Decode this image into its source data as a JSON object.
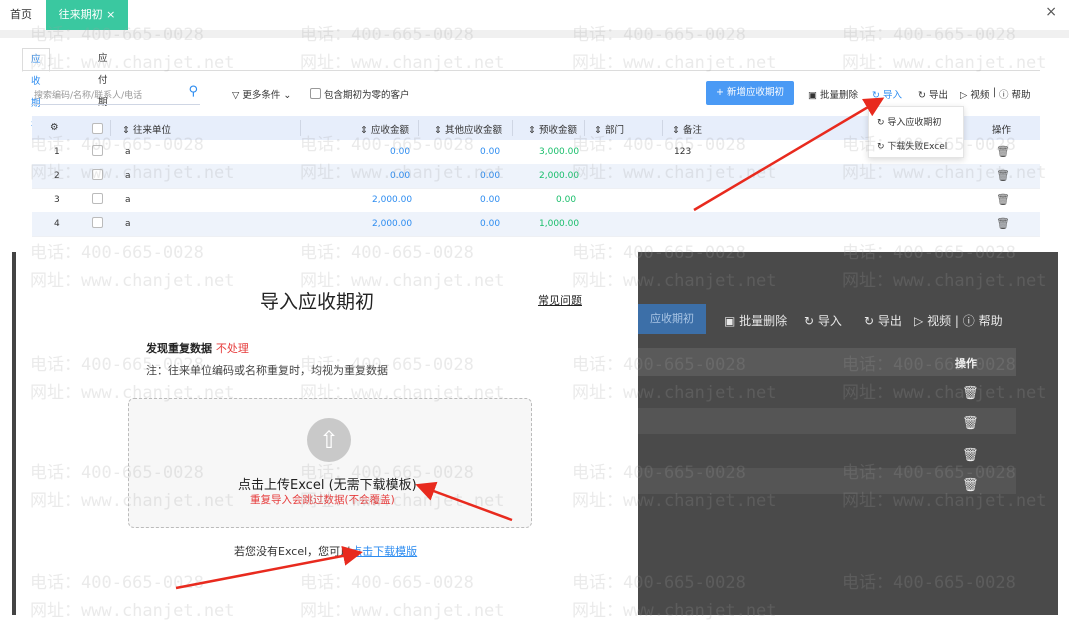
{
  "top_tabs": {
    "home": "首页",
    "active": "往来期初",
    "close_active": "×",
    "close_window": "×"
  },
  "sub_tabs": {
    "receivable": "应收期初",
    "payable": "应付期初"
  },
  "toolbar": {
    "search_placeholder": "搜索编码/名称/联系人/电话",
    "more_conditions": "更多条件",
    "include_zero": "包含期初为零的客户",
    "new_button": "+ 新增应收期初",
    "batch_delete": "批量删除",
    "import": "导入",
    "export": "导出",
    "video": "视频",
    "help": "帮助"
  },
  "table": {
    "headers": {
      "unit": "往来单位",
      "receivable": "应收金额",
      "other": "其他应收金额",
      "prepaid": "预收金额",
      "dept": "部门",
      "remark": "备注",
      "action": "操作"
    },
    "rows": [
      {
        "no": "1",
        "unit": "a",
        "receivable": "0.00",
        "other": "0.00",
        "prepaid": "3,000.00",
        "remark": "123"
      },
      {
        "no": "2",
        "unit": "a",
        "receivable": "0.00",
        "other": "0.00",
        "prepaid": "2,000.00",
        "remark": ""
      },
      {
        "no": "3",
        "unit": "a",
        "receivable": "2,000.00",
        "other": "0.00",
        "prepaid": "0.00",
        "remark": ""
      },
      {
        "no": "4",
        "unit": "a",
        "receivable": "2,000.00",
        "other": "0.00",
        "prepaid": "1,000.00",
        "remark": ""
      }
    ]
  },
  "dropdown": {
    "import_receivable": "导入应收期初",
    "download_failed": "下载失败Excel"
  },
  "dialog": {
    "title": "导入应收期初",
    "faq": "常见问题",
    "dup_label": "发现重复数据",
    "dup_value": "不处理",
    "note": "注：往来单位编码或名称重复时，均视为重复数据",
    "upload_text": "点击上传Excel (无需下载模板)",
    "upload_warning": "重复导入会跳过数据(不会覆盖)",
    "template_prefix": "若您没有Excel，您可以",
    "template_link": "点击下载模版"
  },
  "overlay": {
    "new_button": "应收期初",
    "batch_delete": "批量删除",
    "import": "导入",
    "export": "导出",
    "video": "视频",
    "help": "帮助",
    "action": "操作"
  },
  "watermark": {
    "phone": "电话：400-665-0028",
    "site": "网址：www.chanjet.net"
  },
  "colors": {
    "accent_tab": "#3ac8a0",
    "primary": "#4a9af5",
    "link": "#2d8cf0",
    "green": "#19be6b",
    "red": "#e63c3c",
    "arrow": "#e82a1e"
  }
}
